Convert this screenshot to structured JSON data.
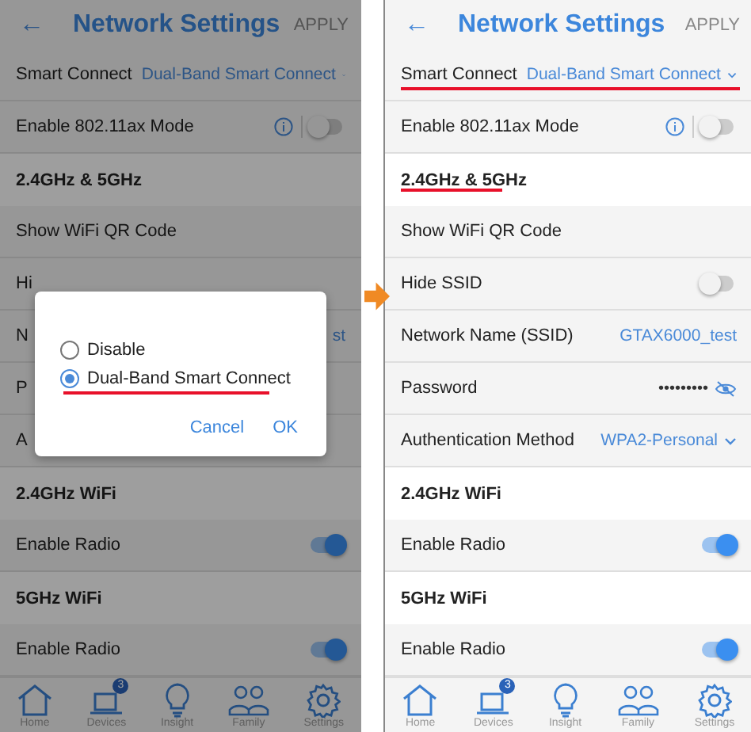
{
  "screens": [
    {
      "header": {
        "back": "←",
        "title": "Network Settings",
        "action": "APPLY"
      },
      "rows": [
        {
          "kind": "select",
          "label": "Smart Connect",
          "value": "Dual-Band Smart Connect",
          "annotated": false
        },
        {
          "kind": "toggle",
          "label": "Enable 802.11ax Mode",
          "info": true,
          "on": false,
          "annotated": false
        },
        {
          "kind": "section",
          "label": "2.4GHz & 5GHz",
          "annotated": false
        },
        {
          "kind": "text",
          "label": "Show WiFi QR Code",
          "annotated": false
        },
        {
          "kind": "text",
          "label": "Hi",
          "annotated": false
        },
        {
          "kind": "text",
          "label": "N",
          "value": "st",
          "annotated": false
        },
        {
          "kind": "text",
          "label": "P",
          "annotated": false
        },
        {
          "kind": "text",
          "label": "A",
          "annotated": false
        },
        {
          "kind": "section",
          "label": "2.4GHz WiFi",
          "annotated": false
        },
        {
          "kind": "toggle",
          "label": "Enable Radio",
          "info": false,
          "on": true,
          "annotated": false
        },
        {
          "kind": "section",
          "label": "5GHz WiFi",
          "annotated": false
        },
        {
          "kind": "toggle",
          "label": "Enable Radio",
          "info": false,
          "on": true,
          "annotated": false
        }
      ],
      "tabs": [
        {
          "label": "Home",
          "selected": false
        },
        {
          "label": "Devices",
          "badge": "3",
          "selected": false
        },
        {
          "label": "Insight",
          "selected": false
        },
        {
          "label": "Family",
          "selected": false
        },
        {
          "label": "Settings",
          "selected": false
        }
      ],
      "dialog": {
        "options": [
          {
            "label": "Disable",
            "selected": false,
            "annotated": false
          },
          {
            "label": "Dual-Band Smart Connect",
            "selected": true,
            "annotated": true
          }
        ],
        "buttons": [
          "Cancel",
          "OK"
        ]
      }
    },
    {
      "header": {
        "back": "←",
        "title": "Network Settings",
        "action": "APPLY"
      },
      "rows": [
        {
          "kind": "select",
          "label": "Smart Connect",
          "value": "Dual-Band Smart Connect",
          "annotated": true
        },
        {
          "kind": "toggle",
          "label": "Enable 802.11ax Mode",
          "info": true,
          "on": false,
          "annotated": false
        },
        {
          "kind": "section",
          "label": "2.4GHz & 5GHz",
          "annotated": true
        },
        {
          "kind": "text",
          "label": "Show WiFi QR Code",
          "annotated": false
        },
        {
          "kind": "toggle",
          "label": "Hide SSID",
          "info": false,
          "on": false,
          "annotated": false
        },
        {
          "kind": "text",
          "label": "Network Name (SSID)",
          "value": "GTAX6000_test",
          "annotated": false
        },
        {
          "kind": "password",
          "label": "Password",
          "value": "•••••••••",
          "annotated": false
        },
        {
          "kind": "select",
          "label": "Authentication Method",
          "value": "WPA2-Personal",
          "annotated": false
        },
        {
          "kind": "section",
          "label": "2.4GHz WiFi",
          "annotated": false
        },
        {
          "kind": "toggle",
          "label": "Enable Radio",
          "info": false,
          "on": true,
          "annotated": false
        },
        {
          "kind": "section",
          "label": "5GHz WiFi",
          "annotated": false
        },
        {
          "kind": "toggle",
          "label": "Enable Radio",
          "info": false,
          "on": true,
          "annotated": false
        }
      ],
      "tabs": [
        {
          "label": "Home",
          "selected": false
        },
        {
          "label": "Devices",
          "badge": "3",
          "selected": false
        },
        {
          "label": "Insight",
          "selected": false
        },
        {
          "label": "Family",
          "selected": false
        },
        {
          "label": "Settings",
          "selected": false
        }
      ]
    }
  ]
}
